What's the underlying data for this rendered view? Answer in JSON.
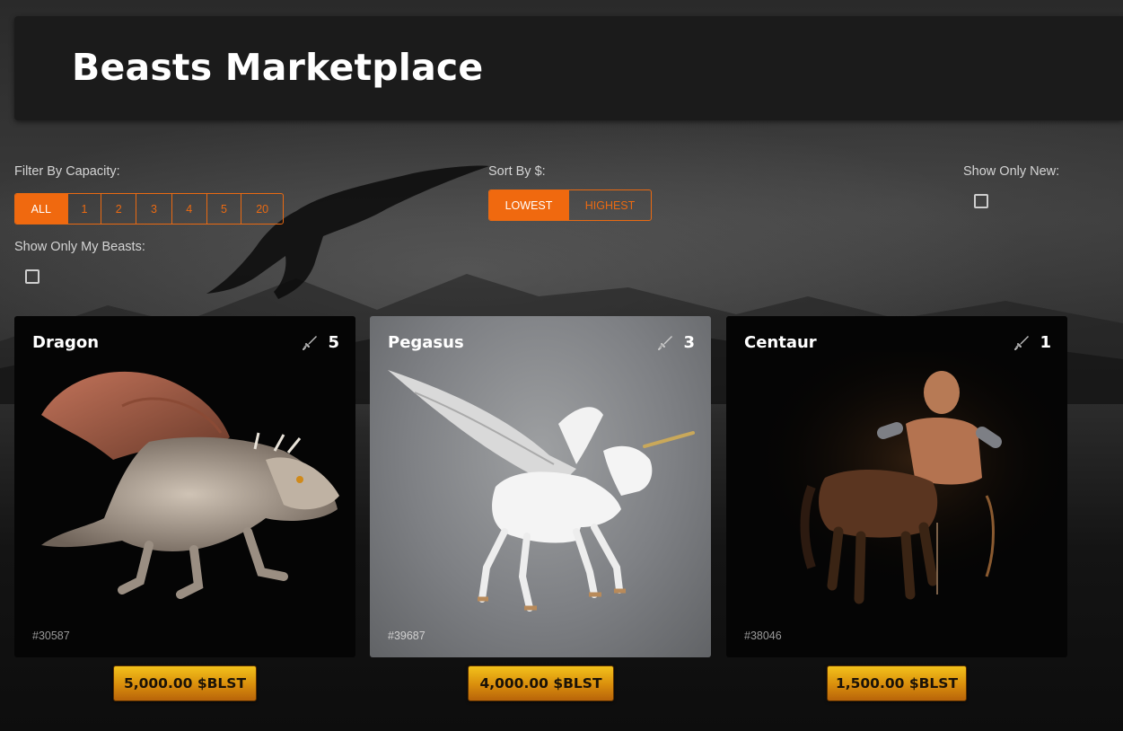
{
  "header": {
    "title": "Beasts Marketplace"
  },
  "filters": {
    "capacity_label": "Filter By Capacity:",
    "capacity_options": [
      "ALL",
      "1",
      "2",
      "3",
      "4",
      "5",
      "20"
    ],
    "capacity_selected": "ALL",
    "sort_label": "Sort By $:",
    "sort_options": [
      "LOWEST",
      "HIGHEST"
    ],
    "sort_selected": "LOWEST",
    "show_new_label": "Show Only New:",
    "show_mine_label": "Show Only My Beasts:"
  },
  "colors": {
    "accent": "#f0690f",
    "price_gold": "#e3a313",
    "card_bg": "#050505"
  },
  "beasts": [
    {
      "name": "Dragon",
      "capacity": "5",
      "id": "#30587",
      "price": "5,000.00 $BLST",
      "icon": "sword-icon"
    },
    {
      "name": "Pegasus",
      "capacity": "3",
      "id": "#39687",
      "price": "4,000.00 $BLST",
      "icon": "sword-icon"
    },
    {
      "name": "Centaur",
      "capacity": "1",
      "id": "#38046",
      "price": "1,500.00 $BLST",
      "icon": "sword-icon"
    }
  ]
}
